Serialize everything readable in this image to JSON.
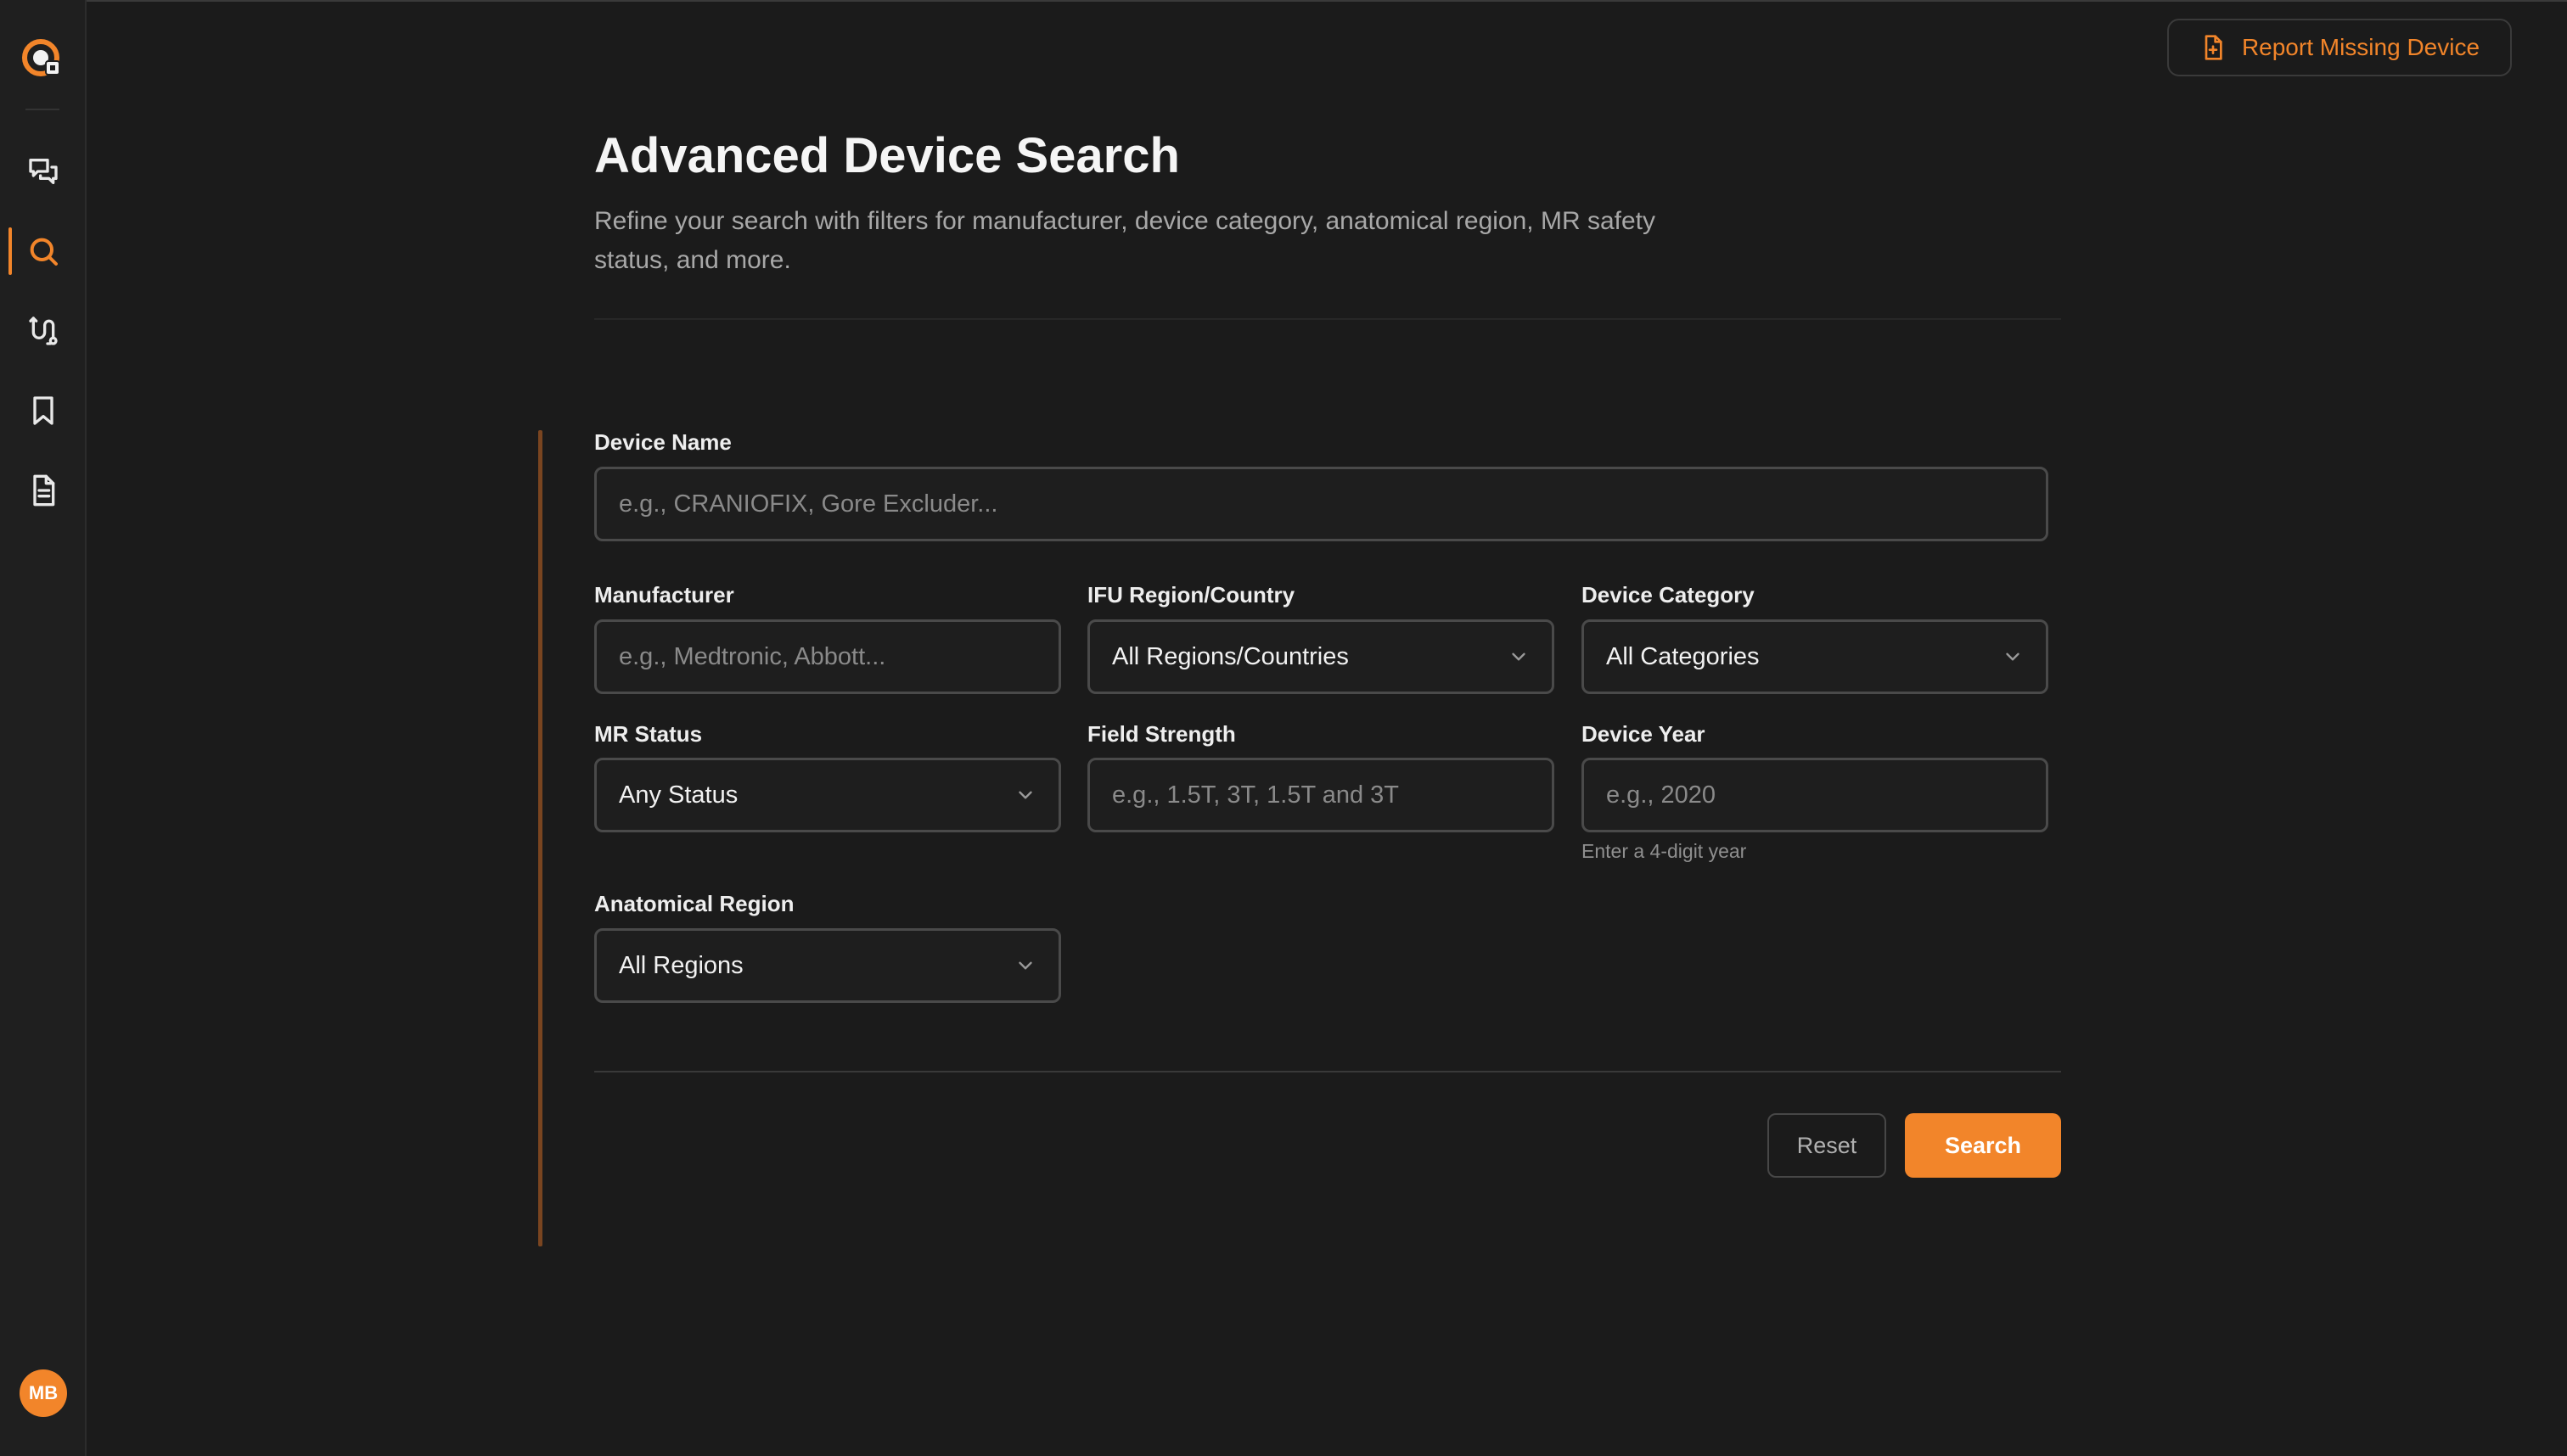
{
  "colors": {
    "accent": "#f2852a",
    "background": "#1b1b1b",
    "sidebar": "#1f1f1f"
  },
  "sidebar": {
    "logo_icon": "app-logo-icon",
    "items": [
      {
        "icon": "chat-icon",
        "active": false
      },
      {
        "icon": "search-icon",
        "active": true
      },
      {
        "icon": "route-icon",
        "active": false
      },
      {
        "icon": "bookmark-icon",
        "active": false
      },
      {
        "icon": "document-icon",
        "active": false
      }
    ],
    "avatar_initials": "MB"
  },
  "header": {
    "report_button_label": "Report Missing Device",
    "title": "Advanced Device Search",
    "subtitle": "Refine your search with filters for manufacturer, device category, anatomical region, MR safety status, and more."
  },
  "form": {
    "device_name": {
      "label": "Device Name",
      "placeholder": "e.g., CRANIOFIX, Gore Excluder...",
      "value": ""
    },
    "manufacturer": {
      "label": "Manufacturer",
      "placeholder": "e.g., Medtronic, Abbott...",
      "value": ""
    },
    "ifu_region": {
      "label": "IFU Region/Country",
      "selected": "All Regions/Countries"
    },
    "device_category": {
      "label": "Device Category",
      "selected": "All Categories"
    },
    "mr_status": {
      "label": "MR Status",
      "selected": "Any Status"
    },
    "field_strength": {
      "label": "Field Strength",
      "placeholder": "e.g., 1.5T, 3T, 1.5T and 3T",
      "value": ""
    },
    "device_year": {
      "label": "Device Year",
      "placeholder": "e.g., 2020",
      "value": "",
      "hint": "Enter a 4-digit year"
    },
    "anatomical_region": {
      "label": "Anatomical Region",
      "selected": "All Regions"
    },
    "reset_label": "Reset",
    "search_label": "Search"
  }
}
